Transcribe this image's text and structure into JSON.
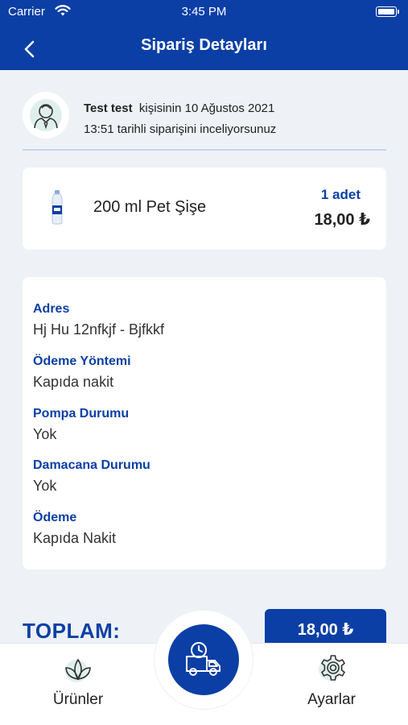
{
  "status_bar": {
    "carrier": "Carrier",
    "time": "3:45 PM"
  },
  "header": {
    "title": "Sipariş Detayları"
  },
  "order_info": {
    "user_name": "Test test",
    "line1_rest": "kişisinin  10 Ağustos 2021",
    "line2": "13:51  tarihli siparişini inceliyorsunuz"
  },
  "product": {
    "name": "200 ml Pet Şişe",
    "quantity": "1 adet",
    "price": "18,00 ₺"
  },
  "details": [
    {
      "label": "Adres",
      "value": "Hj Hu 12nfkjf - Bjfkkf"
    },
    {
      "label": "Ödeme Yöntemi",
      "value": "Kapıda nakit"
    },
    {
      "label": "Pompa Durumu",
      "value": "Yok"
    },
    {
      "label": "Damacana Durumu",
      "value": "Yok"
    },
    {
      "label": "Ödeme",
      "value": "Kapıda Nakit"
    }
  ],
  "total": {
    "label": "TOPLAM:",
    "value": "18,00 ₺"
  },
  "tabbar": {
    "products_label": "Ürünler",
    "settings_label": "Ayarlar"
  },
  "colors": {
    "brand": "#0b3fa6",
    "background": "#eef1f5",
    "card": "#ffffff"
  },
  "icons": [
    "back-chevron-icon",
    "wifi-icon",
    "battery-icon",
    "user-avatar-icon",
    "water-bottle-icon",
    "leaves-icon",
    "delivery-truck-clock-icon",
    "gear-icon"
  ]
}
